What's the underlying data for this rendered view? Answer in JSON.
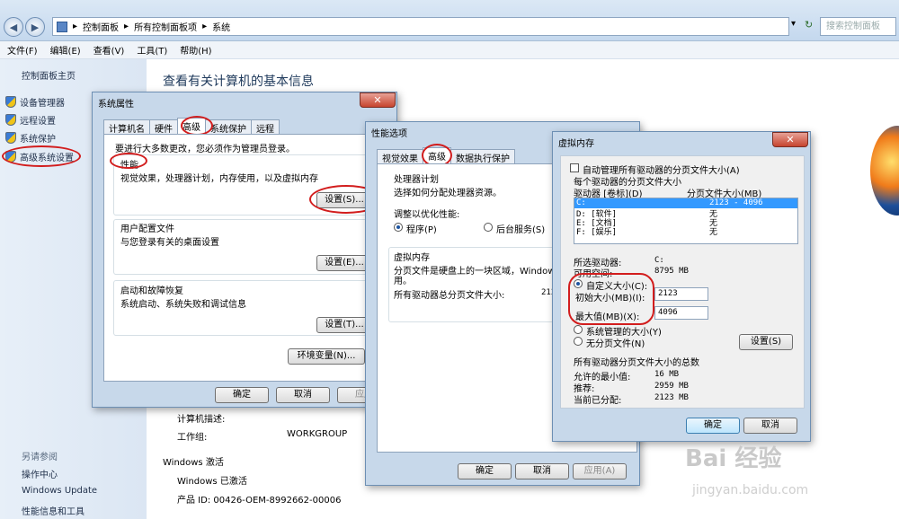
{
  "explorer": {
    "address": [
      "控制面板",
      "所有控制面板项",
      "系统"
    ],
    "search_placeholder": "搜索控制面板",
    "menu": [
      "文件(F)",
      "编辑(E)",
      "查看(V)",
      "工具(T)",
      "帮助(H)"
    ]
  },
  "left_pane": {
    "home": "控制面板主页",
    "items": [
      "设备管理器",
      "远程设置",
      "系统保护",
      "高级系统设置"
    ],
    "see_also_title": "另请参阅",
    "see_also": [
      "操作中心",
      "Windows Update",
      "性能信息和工具"
    ]
  },
  "main": {
    "title": "查看有关计算机的基本信息",
    "rows": [
      {
        "label": "计算机描述:",
        "value": ""
      },
      {
        "label": "工作组:",
        "value": "WORKGROUP"
      }
    ],
    "activation_title": "Windows 激活",
    "activation_status": "Windows 已激活",
    "product_id": "产品 ID: 00426-OEM-8992662-00006"
  },
  "sysprops": {
    "title": "系统属性",
    "tabs": [
      "计算机名",
      "硬件",
      "高级",
      "系统保护",
      "远程"
    ],
    "admin_note": "要进行大多数更改，您必须作为管理员登录。",
    "perf_title": "性能",
    "perf_desc": "视觉效果，处理器计划，内存使用，以及虚拟内存",
    "perf_btn": "设置(S)...",
    "profile_title": "用户配置文件",
    "profile_desc": "与您登录有关的桌面设置",
    "profile_btn": "设置(E)...",
    "startup_title": "启动和故障恢复",
    "startup_desc": "系统启动、系统失败和调试信息",
    "startup_btn": "设置(T)...",
    "env_btn": "环境变量(N)...",
    "ok": "确定",
    "cancel": "取消",
    "apply": "应用"
  },
  "perfopts": {
    "title": "性能选项",
    "tabs": [
      "视觉效果",
      "高级",
      "数据执行保护"
    ],
    "sched_title": "处理器计划",
    "sched_desc": "选择如何分配处理器资源。",
    "optimize_label": "调整以优化性能:",
    "opt_programs": "程序(P)",
    "opt_services": "后台服务(S)",
    "vm_title": "虚拟内存",
    "vm_desc_1": "分页文件是硬盘上的一块区域，Windows",
    "vm_desc_2": "用。",
    "vm_total_label": "所有驱动器总分页文件大小:",
    "vm_total_value": "212",
    "ok": "确定",
    "cancel": "取消",
    "apply": "应用(A)"
  },
  "virtmem": {
    "title": "虚拟内存",
    "auto_manage": "自动管理所有驱动器的分页文件大小(A)",
    "per_drive_title": "每个驱动器的分页文件大小",
    "col_drive": "驱动器 [卷标](D)",
    "col_size": "分页文件大小(MB)",
    "drives": [
      {
        "drive": "C:",
        "size": "2123 - 4096"
      },
      {
        "drive": "D:     [软件]",
        "size": "无"
      },
      {
        "drive": "E:     [文档]",
        "size": "无"
      },
      {
        "drive": "F:     [娱乐]",
        "size": "无"
      }
    ],
    "selected_drive_label": "所选驱动器:",
    "selected_drive_value": "C:",
    "free_space_label": "可用空间:",
    "free_space_value": "8795 MB",
    "custom_size": "自定义大小(C):",
    "initial_label": "初始大小(MB)(I):",
    "initial_value": "2123",
    "max_label": "最大值(MB)(X):",
    "max_value": "4096",
    "system_managed": "系统管理的大小(Y)",
    "no_paging": "无分页文件(N)",
    "set_btn": "设置(S)",
    "total_title": "所有驱动器分页文件大小的总数",
    "min_label": "允许的最小值:",
    "min_value": "16 MB",
    "rec_label": "推荐:",
    "rec_value": "2959 MB",
    "cur_label": "当前已分配:",
    "cur_value": "2123 MB",
    "ok": "确定",
    "cancel": "取消"
  },
  "watermark": {
    "brand": "Bai 经验",
    "url": "jingyan.baidu.com"
  }
}
